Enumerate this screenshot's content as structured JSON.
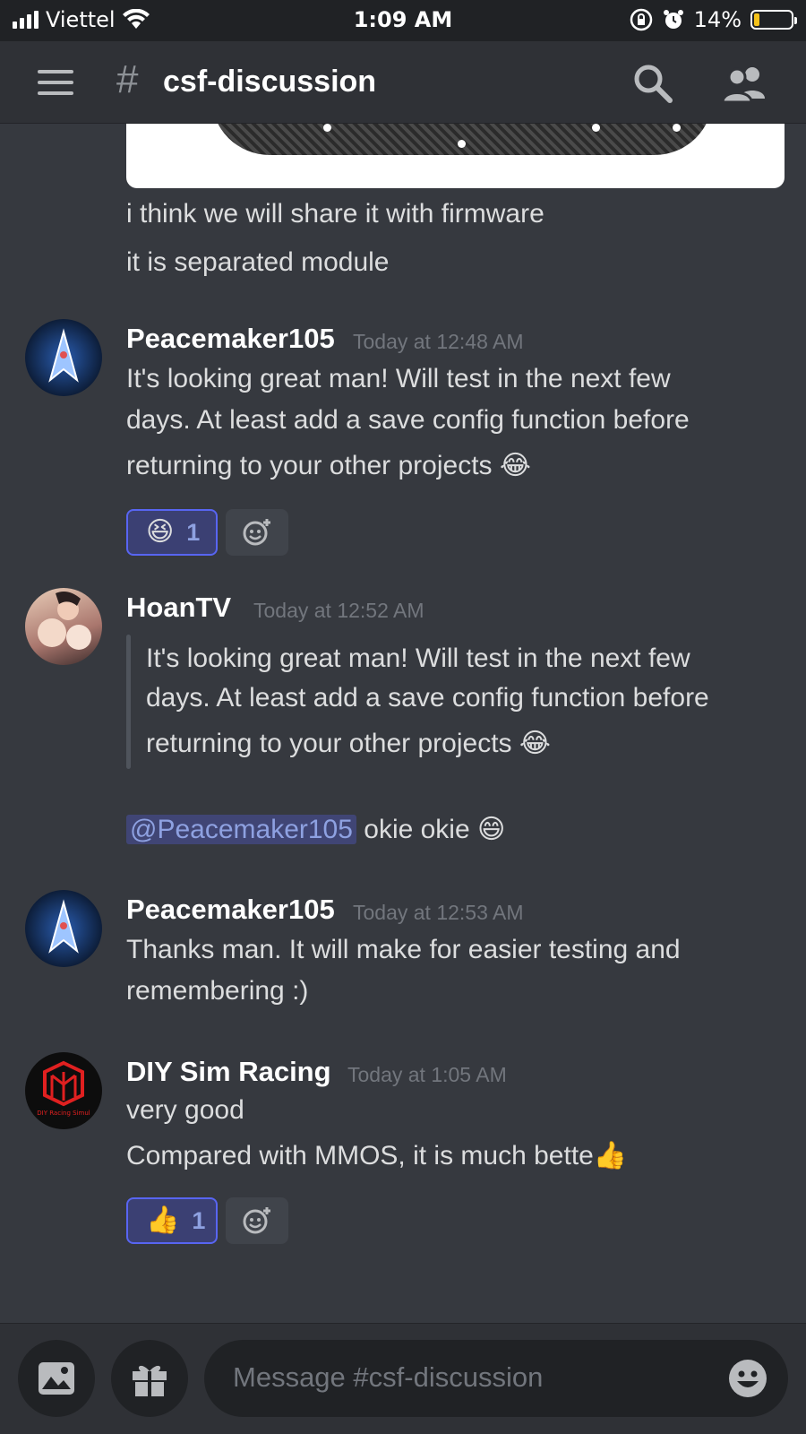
{
  "status_bar": {
    "carrier": "Viettel",
    "time": "1:09 AM",
    "battery_percent": "14%",
    "battery_level": 0.14
  },
  "header": {
    "hash": "#",
    "channel_name": "csf-discussion",
    "icons": [
      "hamburger-menu-icon",
      "search-icon",
      "members-icon"
    ]
  },
  "messages": {
    "m0": {
      "lines": [
        "i think we will share it with firmware",
        "it is separated module"
      ]
    },
    "m1": {
      "author": "Peacemaker105",
      "timestamp": "Today at 12:48 AM",
      "lines": [
        "It's looking great man! Will test in the next few",
        "days. At least add a save config function before",
        "returning to your other projects 😂"
      ],
      "reaction": {
        "emoji": "😆",
        "count": "1"
      }
    },
    "m2": {
      "author": "HoanTV",
      "timestamp": "Today at 12:52 AM",
      "quote_lines": [
        "It's looking great man! Will test in the next few",
        "days. At least add a save config function before",
        "returning to your other projects 😂"
      ],
      "mention": "@Peacemaker105",
      "reply_text": " okie okie 😄"
    },
    "m3": {
      "author": "Peacemaker105",
      "timestamp": "Today at 12:53 AM",
      "lines": [
        "Thanks man. It will make for easier testing and",
        "remembering :)"
      ]
    },
    "m4": {
      "author": "DIY Sim Racing",
      "timestamp": "Today at 1:05 AM",
      "lines": [
        "very good",
        "Compared with MMOS, it is much bette👍"
      ],
      "reaction": {
        "emoji": "👍",
        "count": "1"
      },
      "avatar_text": "DIY Racing Simul"
    }
  },
  "composer": {
    "placeholder": "Message #csf-discussion",
    "icons": [
      "image-upload-icon",
      "gift-icon",
      "emoji-picker-icon"
    ]
  },
  "colors": {
    "background": "#36393f",
    "header": "#2f3136",
    "accent": "#5865f2",
    "mention_text": "#8ea1e1"
  }
}
